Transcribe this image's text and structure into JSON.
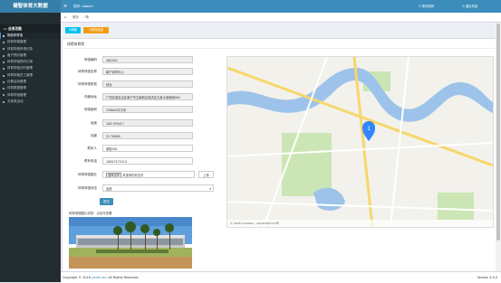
{
  "header": {
    "brand": "健智体育大数据",
    "menu_icon": "hamburger-icon",
    "welcome": "您好: adapin",
    "modify_password": "修改密码",
    "logout": "退出系统"
  },
  "sidebar": {
    "section_title": "业务功能",
    "items": [
      {
        "label": "场馆体育馆",
        "active": true
      },
      {
        "label": "体育场馆管理",
        "active": false
      },
      {
        "label": "体育场馆申请记录",
        "active": false
      },
      {
        "label": "客户预约管理",
        "active": false
      },
      {
        "label": "体育场馆预约记录",
        "active": false
      },
      {
        "label": "体育场馆分时管理",
        "active": false
      },
      {
        "label": "体育场馆员工管理",
        "active": false
      },
      {
        "label": "比赛活动管理",
        "active": false
      },
      {
        "label": "体育数据管理",
        "active": false
      },
      {
        "label": "体育场馆管理",
        "active": false
      },
      {
        "label": "文体类活动",
        "active": false
      }
    ]
  },
  "tabs": {
    "home": "首页",
    "current": "场馆体育馆"
  },
  "toolbar": {
    "refresh": "刷新",
    "edit": "修改信息"
  },
  "panel": {
    "title": "场馆体育馆"
  },
  "form": {
    "fields": [
      {
        "label": "场馆编码",
        "value": "480100"
      },
      {
        "label": "体育场馆名称",
        "value": "南宁体育中心"
      },
      {
        "label": "体育场馆类型",
        "value": "综合"
      },
      {
        "label": "详细地址",
        "value": "广西壮族自治区南宁市五象新区良庆区五象大道南侧005"
      },
      {
        "label": "场馆面积",
        "value": "338000平方米"
      },
      {
        "label": "经度",
        "value": "108.393417"
      },
      {
        "label": "纬度",
        "value": "22.76648"
      },
      {
        "label": "联系人",
        "value": "健智001"
      },
      {
        "label": "联系电话",
        "value": "18007475414"
      }
    ],
    "file_label": "体育场馆图片",
    "file_button": "选择文件",
    "file_status": "未选择任何文件",
    "upload": "上传",
    "status_label": "体育场馆状态",
    "status_value": "运营",
    "submit": "提交",
    "image_caption": "体育场馆图片浏览：点击可查看"
  },
  "map": {
    "attribution": "© 2018 AutoNavi - GS(2018)5173号",
    "colors": {
      "river": "#9dc3ea",
      "park": "#cbe6b4",
      "road": "#f7d76b",
      "pin": "#3385ff"
    }
  },
  "footer": {
    "copyright_prefix": "Copyright © 2018",
    "company": "jnsoft.com",
    "rights": "All Rights Reserved.",
    "version": "Version 4.0.0"
  }
}
